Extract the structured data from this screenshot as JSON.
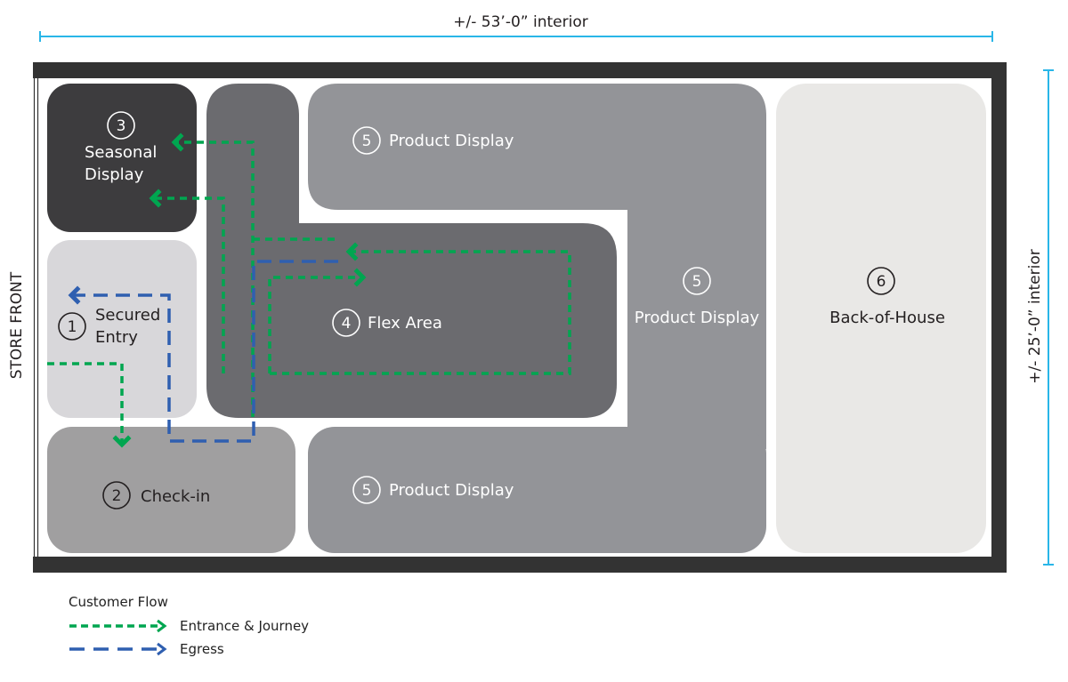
{
  "dimensions": {
    "width_label": "+/- 53’-0” interior",
    "height_label": "+/- 25’-0” interior",
    "store_front_label": "STORE FRONT"
  },
  "zones": [
    {
      "id": "secured-entry",
      "number": "1",
      "lines": [
        "Secured",
        "Entry"
      ],
      "fill": "#d8d7da",
      "text_color": "#231f20"
    },
    {
      "id": "check-in",
      "number": "2",
      "lines": [
        "Check-in"
      ],
      "fill": "#a09fa0",
      "text_color": "#231f20"
    },
    {
      "id": "seasonal-display",
      "number": "3",
      "lines": [
        "Seasonal",
        "Display"
      ],
      "fill": "#3d3c3e",
      "text_color": "#ffffff"
    },
    {
      "id": "flex-area",
      "number": "4",
      "lines": [
        "Flex Area"
      ],
      "fill": "#6b6b6f",
      "text_color": "#ffffff"
    },
    {
      "id": "product-display-top",
      "number": "5",
      "lines": [
        "Product Display"
      ],
      "fill": "#939498",
      "text_color": "#ffffff"
    },
    {
      "id": "product-display-right",
      "number": "5",
      "lines": [
        "Product Display"
      ],
      "fill": "#939498",
      "text_color": "#ffffff"
    },
    {
      "id": "product-display-bottom",
      "number": "5",
      "lines": [
        "Product Display"
      ],
      "fill": "#939498",
      "text_color": "#ffffff"
    },
    {
      "id": "back-of-house",
      "number": "6",
      "lines": [
        "Back-of-House"
      ],
      "fill": "#e9e8e6",
      "text_color": "#231f20"
    }
  ],
  "colors": {
    "wall": "#333333",
    "dimension_line": "#29b6e8",
    "entrance_flow": "#00a650",
    "egress_flow": "#2f5fb0"
  },
  "legend": {
    "title": "Customer Flow",
    "items": [
      {
        "label": "Entrance & Journey",
        "style": "short-dash",
        "color": "#00a650"
      },
      {
        "label": "Egress",
        "style": "long-dash",
        "color": "#2f5fb0"
      }
    ]
  }
}
